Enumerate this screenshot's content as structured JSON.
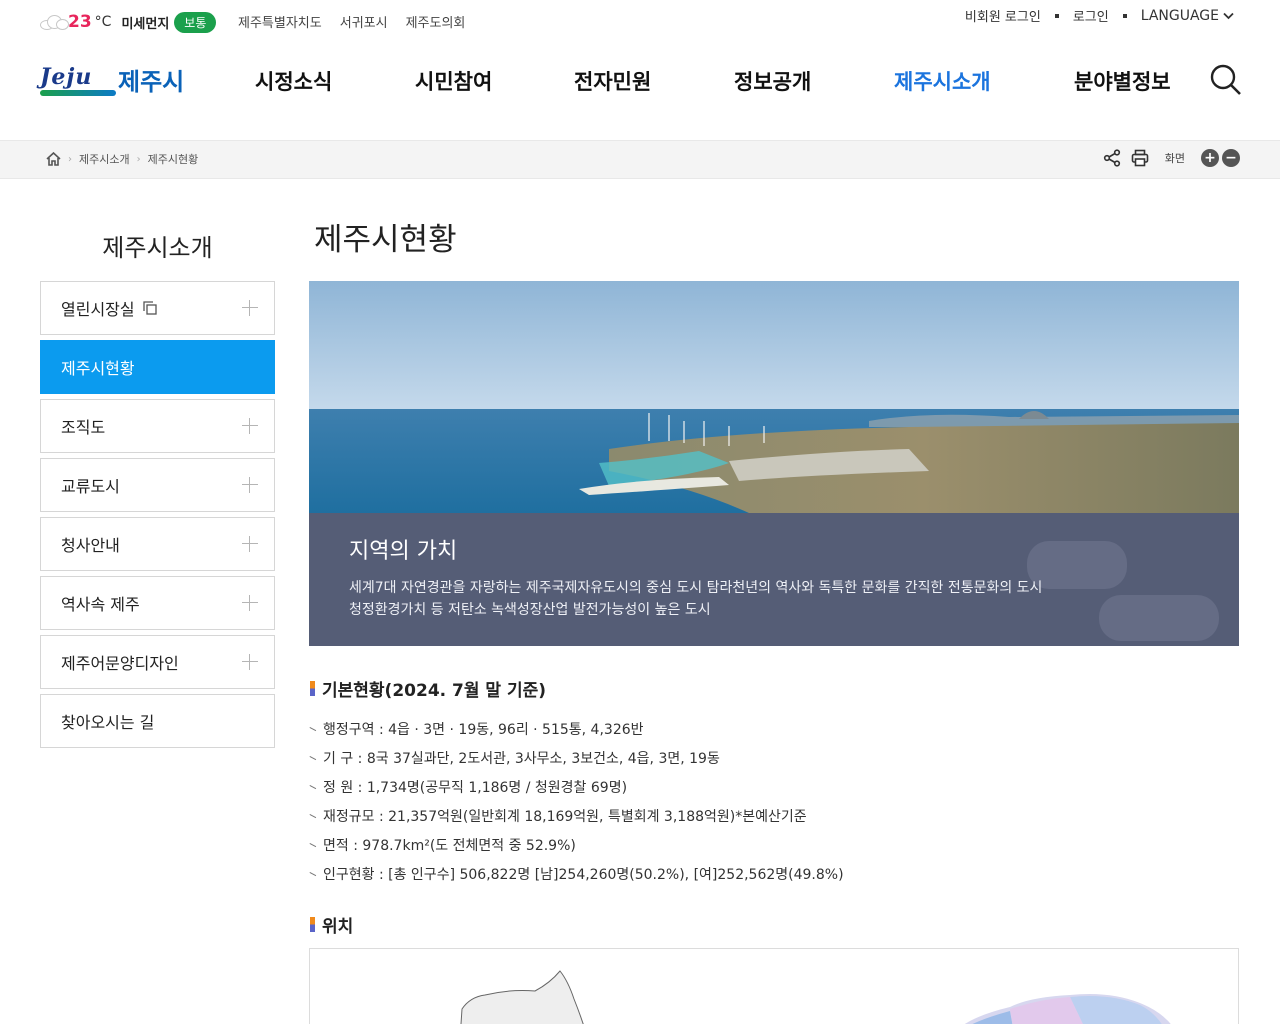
{
  "weather": {
    "temperature": "23",
    "unit": "°C",
    "dust_label": "미세먼지",
    "dust_status": "보통",
    "dust_color": "#1ba04c"
  },
  "util_links": [
    "제주특별자치도",
    "서귀포시",
    "제주도의회"
  ],
  "account": {
    "guest_login": "비회원 로그인",
    "login": "로그인",
    "language": "LANGUAGE"
  },
  "logo": {
    "english": "Jeju",
    "korean": "제주시"
  },
  "gnb": [
    {
      "label": "시정소식",
      "active": false
    },
    {
      "label": "시민참여",
      "active": false
    },
    {
      "label": "전자민원",
      "active": false
    },
    {
      "label": "정보공개",
      "active": false
    },
    {
      "label": "제주시소개",
      "active": true
    },
    {
      "label": "분야별정보",
      "active": false
    }
  ],
  "breadcrumb": [
    "제주시소개",
    "제주시현황"
  ],
  "tools": {
    "zoom_label": "화면",
    "zoom_in": "+",
    "zoom_out": "−"
  },
  "lnb": {
    "title": "제주시소개",
    "items": [
      {
        "label": "열린시장실",
        "active": false,
        "expandable": true,
        "new_window": true
      },
      {
        "label": "제주시현황",
        "active": true,
        "expandable": false,
        "new_window": false
      },
      {
        "label": "조직도",
        "active": false,
        "expandable": true,
        "new_window": false
      },
      {
        "label": "교류도시",
        "active": false,
        "expandable": true,
        "new_window": false
      },
      {
        "label": "청사안내",
        "active": false,
        "expandable": true,
        "new_window": false
      },
      {
        "label": "역사속 제주",
        "active": false,
        "expandable": true,
        "new_window": false
      },
      {
        "label": "제주어문양디자인",
        "active": false,
        "expandable": true,
        "new_window": false
      },
      {
        "label": "찾아오시는 길",
        "active": false,
        "expandable": false,
        "new_window": false
      }
    ]
  },
  "page": {
    "title": "제주시현황",
    "hero": {
      "heading": "지역의 가치",
      "lines": [
        "세계7대 자연경관을 자랑하는 제주국제자유도시의 중심 도시 탐라천년의 역사와 독특한 문화를 간직한 전통문화의 도시",
        "청정환경가치 등 저탄소 녹색성장산업 발전가능성이 높은 도시"
      ]
    },
    "basic_title": "기본현황(2024. 7월 말 기준)",
    "facts": [
      "행정구역 : 4읍 · 3면 · 19동, 96리 · 515통, 4,326반",
      "기 구 : 8국 37실과단, 2도서관, 3사무소, 3보건소, 4읍, 3면, 19동",
      "정 원 : 1,734명(공무직 1,186명 / 청원경찰 69명)",
      "재정규모 : 21,357억원(일반회계 18,169억원, 특별회계 3,188억원)*본예산기준",
      "면적 : 978.7km²(도 전체면적 중 52.9%)",
      "인구현황 : [총 인구수] 506,822명 [남]254,260명(50.2%), [여]252,562명(49.8%)"
    ],
    "location_title": "위치"
  },
  "colors": {
    "accent": "#1b74de",
    "lnb_active": "#0b9bef",
    "temp": "#e8265c",
    "hero_panel": "#555d76"
  }
}
